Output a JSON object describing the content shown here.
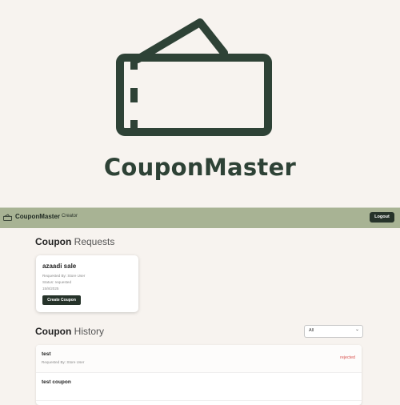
{
  "hero": {
    "title": "CouponMaster",
    "logo_icon": "ticket-icon"
  },
  "navbar": {
    "icon": "ticket-icon",
    "brand": "CouponMaster",
    "role": "Creator",
    "logout_label": "Logout"
  },
  "requests": {
    "title_bold": "Coupon",
    "title_light": "Requests",
    "cards": [
      {
        "title": "azaadi sale",
        "requested_by": "Requested By: Store User",
        "status": "Status: requested",
        "date": "15/8/2025",
        "button_label": "Create Coupon"
      }
    ]
  },
  "history": {
    "title_bold": "Coupon",
    "title_light": "History",
    "filter_value": "All",
    "rows": [
      {
        "title": "test",
        "requested_by": "Requested By: Store User",
        "status": "rejected"
      },
      {
        "title": "test coupon",
        "requested_by": "",
        "status": ""
      }
    ]
  },
  "colors": {
    "brand_dark": "#2e4236",
    "navbar_bg": "#a8b394",
    "button_bg": "#26332a",
    "page_bg": "#f7f3ef",
    "rejected": "#d9534f"
  }
}
